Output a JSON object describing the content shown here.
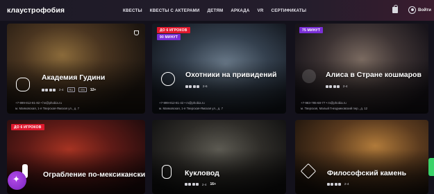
{
  "header": {
    "logo": "клаустрофобия",
    "nav": [
      "КВЕСТЫ",
      "КВЕСТЫ С АКТЕРАМИ",
      "ДЕТЯМ",
      "АРКАДА",
      "VR",
      "СЕРТИФИКАТЫ"
    ],
    "login_label": "Войти",
    "icons": {
      "cart": "bag-icon",
      "login": "user-circle-icon"
    }
  },
  "cards": [
    {
      "title": "Академия Гудини",
      "badges": [],
      "players": "2-4",
      "chips": [
        "RU",
        "EN"
      ],
      "age": "12+",
      "phone": "+7-999-812-81-82 • hn@phobia.ru",
      "address": "м. Маяковская, 1-я Тверская-Ямская ул., д. 7",
      "icon": "handcuffs-icon"
    },
    {
      "title": "Охотники на привидений",
      "badges": [
        "ДО 6 ИГРОКОВ",
        "90 МИНУТ"
      ],
      "players": "2-6",
      "chips": [],
      "age": "",
      "phone": "+7-999-812-81-42 • m@phobia.ru",
      "address": "м. Маяковская, 1-я Тверская-Ямская ул., д. 7",
      "icon": "ghost-icon"
    },
    {
      "title": "Алиса в Стране кошмаров",
      "badges": [
        "75 МИНУТ"
      ],
      "players": "2-4",
      "chips": [],
      "age": "",
      "phone": "+7-983-785-68-77 • m@phobia.ru",
      "address": "м. Тверская, Малый Гнездниковский пер., д. 12",
      "icon": "rabbit-icon"
    },
    {
      "title": "Ограбление по-мексикански",
      "badges": [
        "ДО 6 ИГРОКОВ"
      ],
      "players": "",
      "chips": [],
      "age": "",
      "phone": "",
      "address": "",
      "icon": "cactus-icon"
    },
    {
      "title": "Кукловод",
      "badges": [],
      "players": "2-4",
      "chips": [],
      "age": "16+",
      "phone": "",
      "address": "",
      "icon": "puppet-icon"
    },
    {
      "title": "Философский камень",
      "badges": [],
      "players": "2-4",
      "chips": [],
      "age": "",
      "phone": "",
      "address": "",
      "icon": "stone-icon"
    }
  ]
}
